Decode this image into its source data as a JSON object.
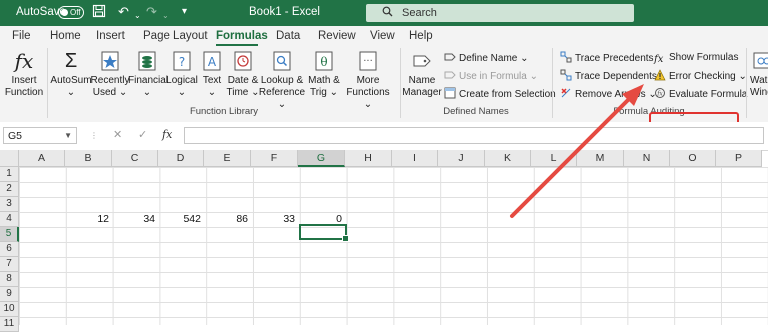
{
  "titlebar": {
    "autosave_label": "AutoSave",
    "autosave_state": "Off",
    "doc_title": "Book1  -  Excel",
    "search_placeholder": "Search"
  },
  "tabs": [
    "File",
    "Home",
    "Insert",
    "Page Layout",
    "Formulas",
    "Data",
    "Review",
    "View",
    "Help"
  ],
  "active_tab": "Formulas",
  "ribbon": {
    "insert_function": [
      "Insert",
      "Function"
    ],
    "function_library": {
      "buttons": [
        {
          "l1": "AutoSum",
          "l2": "⌄"
        },
        {
          "l1": "Recently",
          "l2": "Used ⌄"
        },
        {
          "l1": "Financial",
          "l2": "⌄"
        },
        {
          "l1": "Logical",
          "l2": "⌄"
        },
        {
          "l1": "Text",
          "l2": "⌄"
        },
        {
          "l1": "Date &",
          "l2": "Time ⌄"
        },
        {
          "l1": "Lookup &",
          "l2": "Reference ⌄"
        },
        {
          "l1": "Math &",
          "l2": "Trig ⌄"
        },
        {
          "l1": "More",
          "l2": "Functions ⌄"
        }
      ],
      "label": "Function Library"
    },
    "defined_names": {
      "name_manager": [
        "Name",
        "Manager"
      ],
      "define_name": "Define Name  ⌄",
      "use_in_formula": "Use in Formula ⌄",
      "create_from_selection": "Create from Selection",
      "label": "Defined Names"
    },
    "formula_auditing": {
      "trace_precedents": "Trace Precedents",
      "trace_dependents": "Trace Dependents",
      "remove_arrows": "Remove Arrows ⌄",
      "show_formulas": "Show Formulas",
      "error_checking": "Error Checking  ⌄",
      "evaluate_formula": "Evaluate Formula",
      "label": "Formula Auditing"
    },
    "watch_window_partial": [
      "Wat",
      "Wind"
    ]
  },
  "formula_bar": {
    "name_box": "G5",
    "fx_label": "fx",
    "formula": ""
  },
  "grid": {
    "columns": [
      "A",
      "B",
      "C",
      "D",
      "E",
      "F",
      "G",
      "H",
      "I",
      "J",
      "K",
      "L",
      "M",
      "N",
      "O",
      "P"
    ],
    "rows": [
      "1",
      "2",
      "3",
      "4",
      "5",
      "6",
      "7",
      "8",
      "9",
      "10",
      "11"
    ],
    "selected_column": "G",
    "selected_row": "5",
    "row4_values": {
      "B": "12",
      "C": "34",
      "D": "542",
      "E": "86",
      "F": "33",
      "G": "0"
    }
  },
  "colors": {
    "excel_green": "#217346",
    "highlight_red": "#e0332f"
  }
}
